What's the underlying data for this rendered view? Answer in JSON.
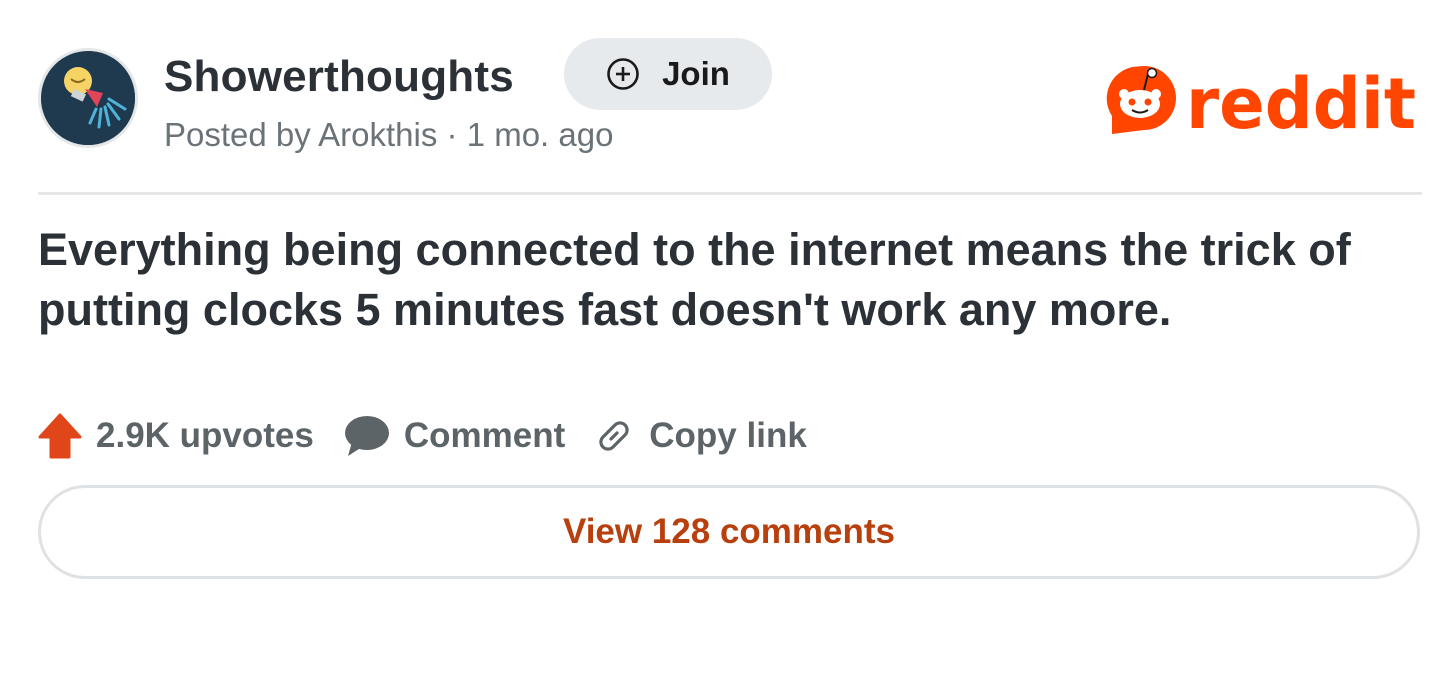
{
  "post": {
    "subreddit": "Showerthoughts",
    "join_label": "Join",
    "posted_prefix": "Posted by",
    "author": "Arokthis",
    "separator": "·",
    "age": "1 mo. ago",
    "title": "Everything being connected to the internet means the trick of putting clocks 5 minutes fast doesn't work any more."
  },
  "brand": {
    "logo_text": "reddit",
    "color": "#ff4500"
  },
  "actions": {
    "upvotes_label": "2.9K upvotes",
    "comment_label": "Comment",
    "copy_link_label": "Copy link"
  },
  "view_comments_label": "View 128 comments",
  "colors": {
    "text": "#2b3136",
    "muted": "#5c6468",
    "accent": "#b8400f",
    "upvote": "#e0461a",
    "button_bg": "#e7eaec"
  },
  "icons": {
    "avatar": "lightbulb-shower-icon",
    "join": "plus-circle-icon",
    "upvote": "upvote-arrow-icon",
    "comment": "speech-bubble-icon",
    "copy_link": "link-icon"
  }
}
